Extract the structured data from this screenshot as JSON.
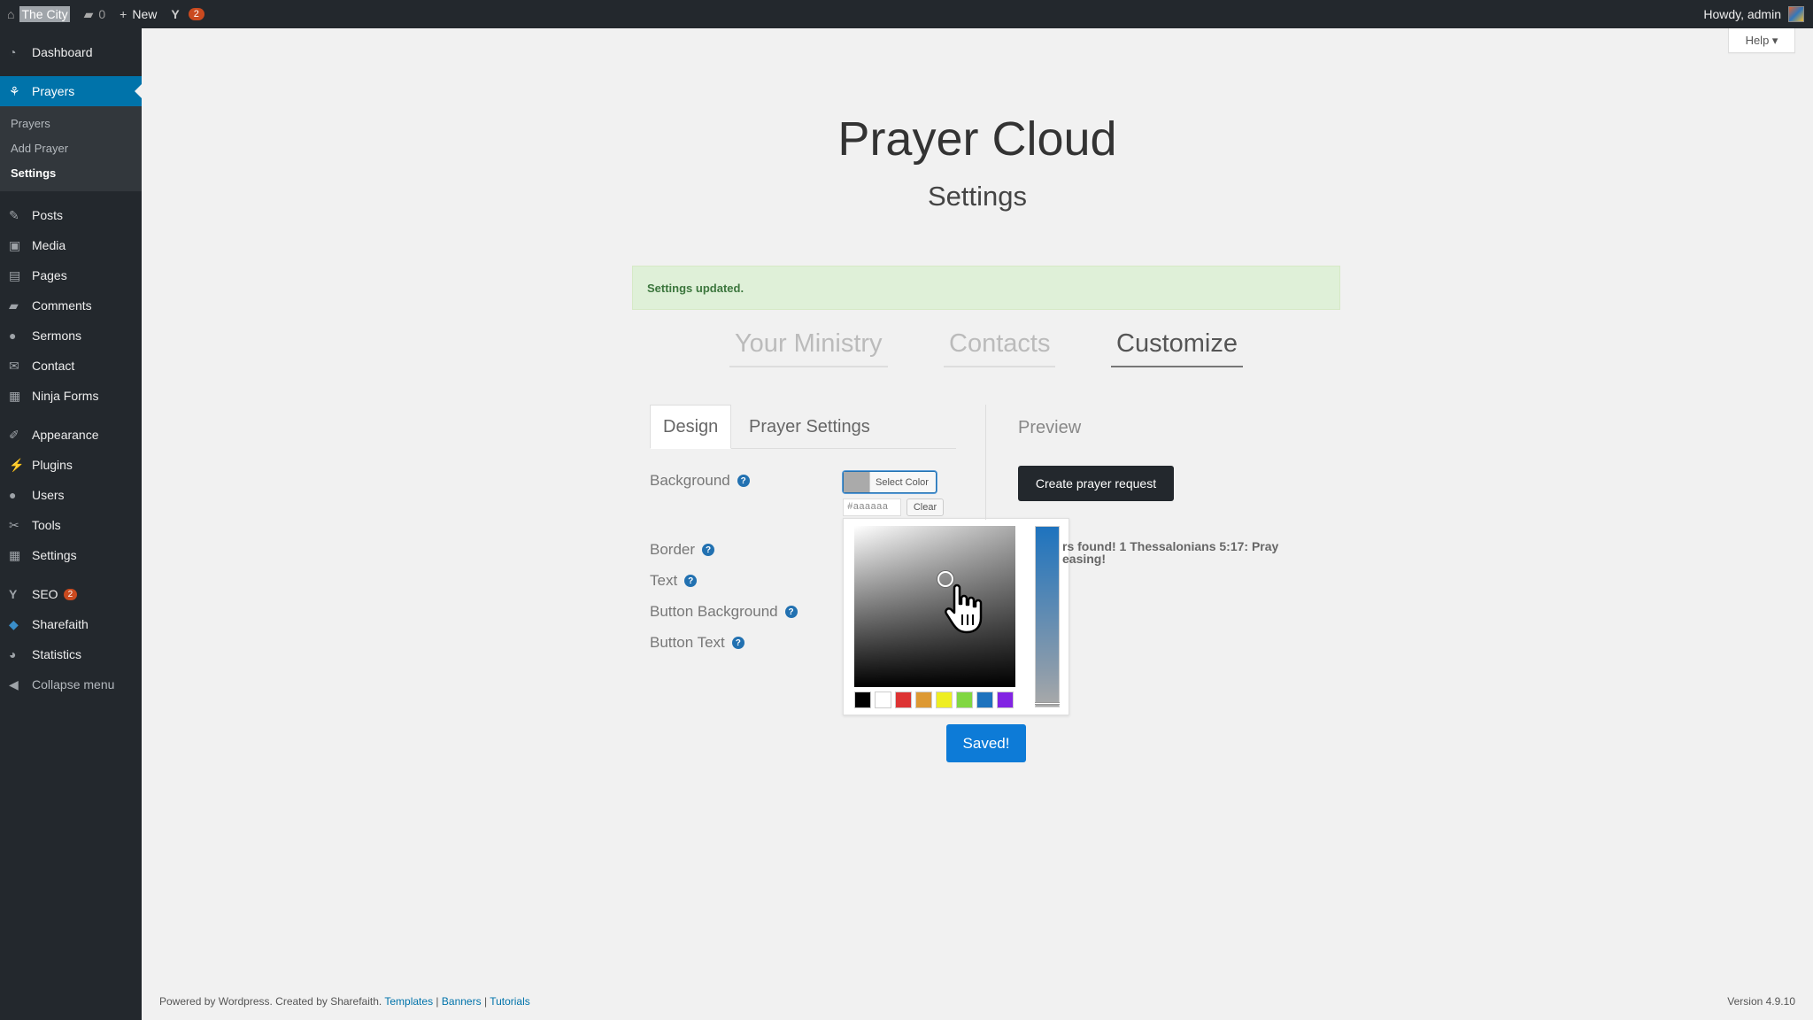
{
  "adminbar": {
    "site_name": "The City",
    "comments_count": "0",
    "new_label": "New",
    "seo_count": "2",
    "howdy": "Howdy, admin",
    "icons": [
      "home-icon",
      "comment-icon",
      "plus-icon",
      "yoast-icon"
    ]
  },
  "sidebar": {
    "dashboard": "Dashboard",
    "prayers": "Prayers",
    "sub_prayers": "Prayers",
    "sub_add": "Add Prayer",
    "sub_settings": "Settings",
    "posts": "Posts",
    "media": "Media",
    "pages": "Pages",
    "comments": "Comments",
    "sermons": "Sermons",
    "contact": "Contact",
    "ninja": "Ninja Forms",
    "appearance": "Appearance",
    "plugins": "Plugins",
    "users": "Users",
    "tools": "Tools",
    "settings": "Settings",
    "seo": "SEO",
    "seo_badge": "2",
    "sharefaith": "Sharefaith",
    "statistics": "Statistics",
    "collapse": "Collapse menu"
  },
  "help_label": "Help ▾",
  "page": {
    "title": "Prayer Cloud",
    "subtitle": "Settings",
    "notice": "Settings updated."
  },
  "main_tabs": {
    "ministry": "Your Ministry",
    "contacts": "Contacts",
    "customize": "Customize"
  },
  "sub_tabs": {
    "design": "Design",
    "prayer_settings": "Prayer Settings"
  },
  "fields": {
    "background": "Background",
    "border": "Border",
    "text": "Text",
    "button_background": "Button Background",
    "button_text": "Button Text",
    "help_glyph": "?"
  },
  "colorpicker": {
    "select_label": "Select Color",
    "hex_value": "#aaaaaa",
    "clear_label": "Clear",
    "current_color": "#aaaaaa",
    "palette": [
      "#000000",
      "#ffffff",
      "#dd3333",
      "#dd9933",
      "#eeee22",
      "#81d742",
      "#1e73be",
      "#8224e3"
    ]
  },
  "preview": {
    "label": "Preview",
    "button": "Create prayer request",
    "text": "rs found! 1 Thessalonians 5:17: Pray\neasing!"
  },
  "saved_label": "Saved!",
  "footer": {
    "text": "Powered by Wordpress. Created by Sharefaith.",
    "templates": "Templates",
    "banners": "Banners",
    "tutorials": "Tutorials",
    "sep": "|",
    "version": "Version 4.9.10"
  }
}
